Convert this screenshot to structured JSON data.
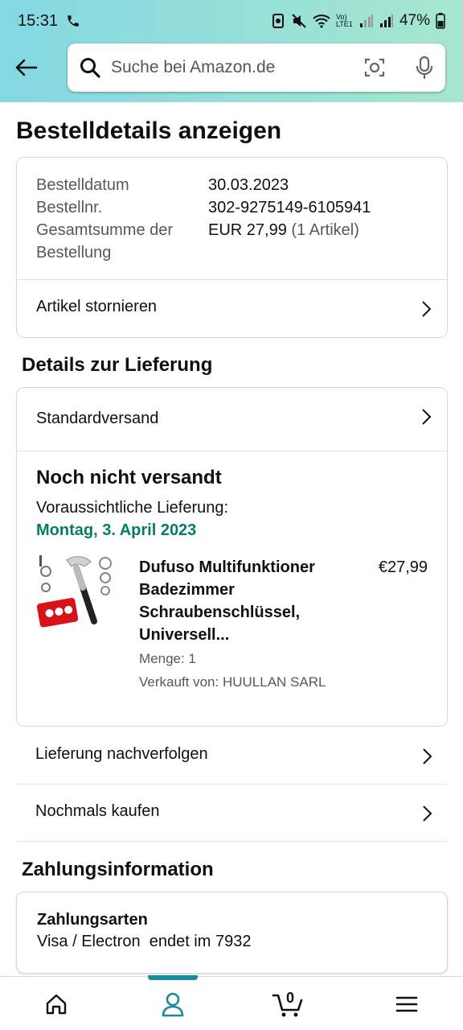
{
  "status_bar": {
    "time": "15:31",
    "battery": "47%",
    "network_label": "Vo) LTE1"
  },
  "search": {
    "placeholder": "Suche bei Amazon.de"
  },
  "page_title": "Bestelldetails anzeigen",
  "order_summary": {
    "rows": [
      {
        "label": "Bestelldatum",
        "value": "30.03.2023"
      },
      {
        "label": "Bestellnr.",
        "value": "302-9275149-6105941"
      },
      {
        "label": "Gesamtsumme der",
        "label_line2": "Bestellung",
        "value": "EUR 27,99",
        "value_suffix": "(1 Artikel)"
      }
    ],
    "cancel_label": "Artikel stornieren"
  },
  "delivery": {
    "section_title": "Details zur Lieferung",
    "shipping_method": "Standardversand",
    "status": "Noch nicht versandt",
    "expected_label": "Voraussichtliche Lieferung:",
    "expected_date": "Montag, 3. April 2023",
    "product": {
      "title_lines": [
        "Dufuso Multifunktioner",
        "Badezimmer",
        "Schraubenschlüssel,",
        "Universell..."
      ],
      "price": "€27,99",
      "quantity": "Menge: 1",
      "seller": "Verkauft von: HUULLAN SARL"
    }
  },
  "actions": {
    "track_label": "Lieferung nachverfolgen",
    "buy_again_label": "Nochmals kaufen"
  },
  "payment": {
    "section_title": "Zahlungsinformation",
    "methods_title": "Zahlungsarten",
    "method_value": "Visa / Electron  endet im 7932"
  },
  "bottom_nav": {
    "cart_count": "0",
    "active_tab": "account"
  },
  "colors": {
    "accent": "#1a8a98",
    "delivery_green": "#067d62",
    "header_gradient_start": "#84d8e3",
    "header_gradient_end": "#a6e6cf"
  }
}
